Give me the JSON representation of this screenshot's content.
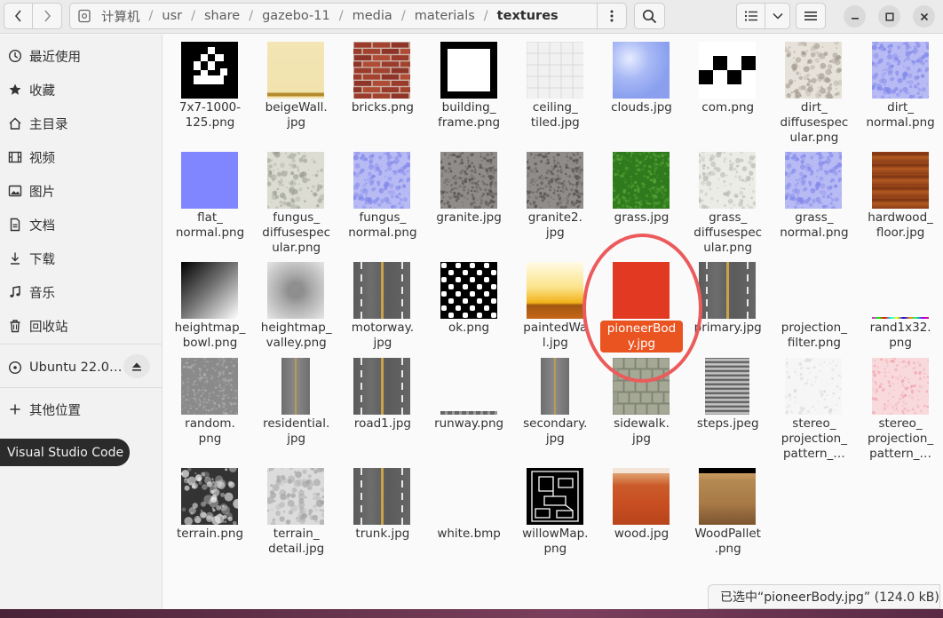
{
  "path": {
    "crumbs": [
      "计算机",
      "usr",
      "share",
      "gazebo-11",
      "media",
      "materials",
      "textures"
    ]
  },
  "sidebar": {
    "items": [
      {
        "label": "最近使用",
        "icon": "clock-icon"
      },
      {
        "label": "收藏",
        "icon": "star-icon"
      },
      {
        "label": "主目录",
        "icon": "home-icon"
      },
      {
        "label": "视频",
        "icon": "film-icon"
      },
      {
        "label": "图片",
        "icon": "picture-icon"
      },
      {
        "label": "文档",
        "icon": "document-icon"
      },
      {
        "label": "下载",
        "icon": "download-icon"
      },
      {
        "label": "音乐",
        "icon": "music-note-icon"
      },
      {
        "label": "回收站",
        "icon": "trash-icon"
      }
    ],
    "device": {
      "label": "Ubuntu 22.0…",
      "icon": "disc-icon"
    },
    "other": {
      "label": "其他位置",
      "icon": "plus-icon"
    }
  },
  "tooltip": "Visual Studio Code",
  "files": [
    {
      "name": "7x7-1000-\n125.png",
      "thumb": "qr"
    },
    {
      "name": "beigeWall.\njpg",
      "thumb": "beige"
    },
    {
      "name": "bricks.png",
      "thumb": "bricks"
    },
    {
      "name": "building_\nframe.png",
      "thumb": "frame"
    },
    {
      "name": "ceiling_\ntiled.jpg",
      "thumb": "ceiling"
    },
    {
      "name": "clouds.jpg",
      "thumb": "clouds"
    },
    {
      "name": "com.png",
      "thumb": "com"
    },
    {
      "name": "dirt_\ndiffusespec\nular.png",
      "thumb": "dirt"
    },
    {
      "name": "dirt_\nnormal.png",
      "thumb": "bluenoise"
    },
    {
      "name": "flat_\nnormal.png",
      "thumb": "flat"
    },
    {
      "name": "fungus_\ndiffusespec\nular.png",
      "thumb": "fungus"
    },
    {
      "name": "fungus_\nnormal.png",
      "thumb": "bluenoise"
    },
    {
      "name": "granite.jpg",
      "thumb": "granite"
    },
    {
      "name": "granite2.\njpg",
      "thumb": "granite"
    },
    {
      "name": "grass.jpg",
      "thumb": "grass"
    },
    {
      "name": "grass_\ndiffusespec\nular.png",
      "thumb": "grassspec"
    },
    {
      "name": "grass_\nnormal.png",
      "thumb": "bluenoise"
    },
    {
      "name": "hardwood_\nfloor.jpg",
      "thumb": "hardwood"
    },
    {
      "name": "heightmap_\nbowl.png",
      "thumb": "bowl"
    },
    {
      "name": "heightmap_\nvalley.png",
      "thumb": "valley"
    },
    {
      "name": "motorway.\njpg",
      "thumb": "road"
    },
    {
      "name": "ok.png",
      "thumb": "ok"
    },
    {
      "name": "paintedWa\nl.jpg",
      "thumb": "painted"
    },
    {
      "name": "pioneerBod\ny.jpg",
      "thumb": "pioneer",
      "selected": true
    },
    {
      "name": "primary.jpg",
      "thumb": "road"
    },
    {
      "name": "projection_\nfilter.png",
      "thumb": "none"
    },
    {
      "name": "rand1x32.\npng",
      "thumb": "rand"
    },
    {
      "name": "random.\npng",
      "thumb": "random"
    },
    {
      "name": "residential.\njpg",
      "thumb": "roadnarrow"
    },
    {
      "name": "road1.jpg",
      "thumb": "road"
    },
    {
      "name": "runway.png",
      "thumb": "runway"
    },
    {
      "name": "secondary.\njpg",
      "thumb": "roadnarrow"
    },
    {
      "name": "sidewalk.\njpg",
      "thumb": "sidewalk"
    },
    {
      "name": "steps.jpeg",
      "thumb": "steps"
    },
    {
      "name": "stereo_\nprojection_\npattern_…",
      "thumb": "stereo1"
    },
    {
      "name": "stereo_\nprojection_\npattern_…",
      "thumb": "stereo2"
    },
    {
      "name": "terrain.png",
      "thumb": "terrain"
    },
    {
      "name": "terrain_\ndetail.jpg",
      "thumb": "terraindetail"
    },
    {
      "name": "trunk.jpg",
      "thumb": "road"
    },
    {
      "name": "white.bmp",
      "thumb": "none"
    },
    {
      "name": "willowMap.\npng",
      "thumb": "willow"
    },
    {
      "name": "wood.jpg",
      "thumb": "wood"
    },
    {
      "name": "WoodPallet\n.png",
      "thumb": "pallet"
    }
  ],
  "status": "已选中“pioneerBody.jpg” (124.0 kB)",
  "colors": {
    "accent": "#e95420",
    "annotation": "#ec5b5b"
  }
}
